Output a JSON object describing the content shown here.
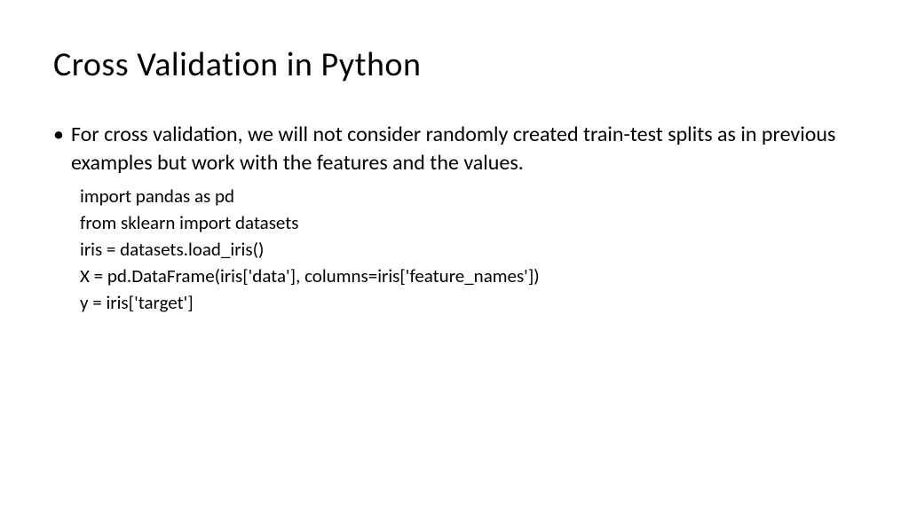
{
  "title": "Cross Validation in Python",
  "bullet": {
    "text": "For cross validation, we will not consider randomly created train-test splits as in previous examples but work with the features and the values."
  },
  "code": {
    "line1": "import pandas as pd",
    "line2": "from sklearn import datasets",
    "line3": "iris = datasets.load_iris()",
    "line4": "X = pd.DataFrame(iris['data'], columns=iris['feature_names'])",
    "line5": "y = iris['target']"
  }
}
